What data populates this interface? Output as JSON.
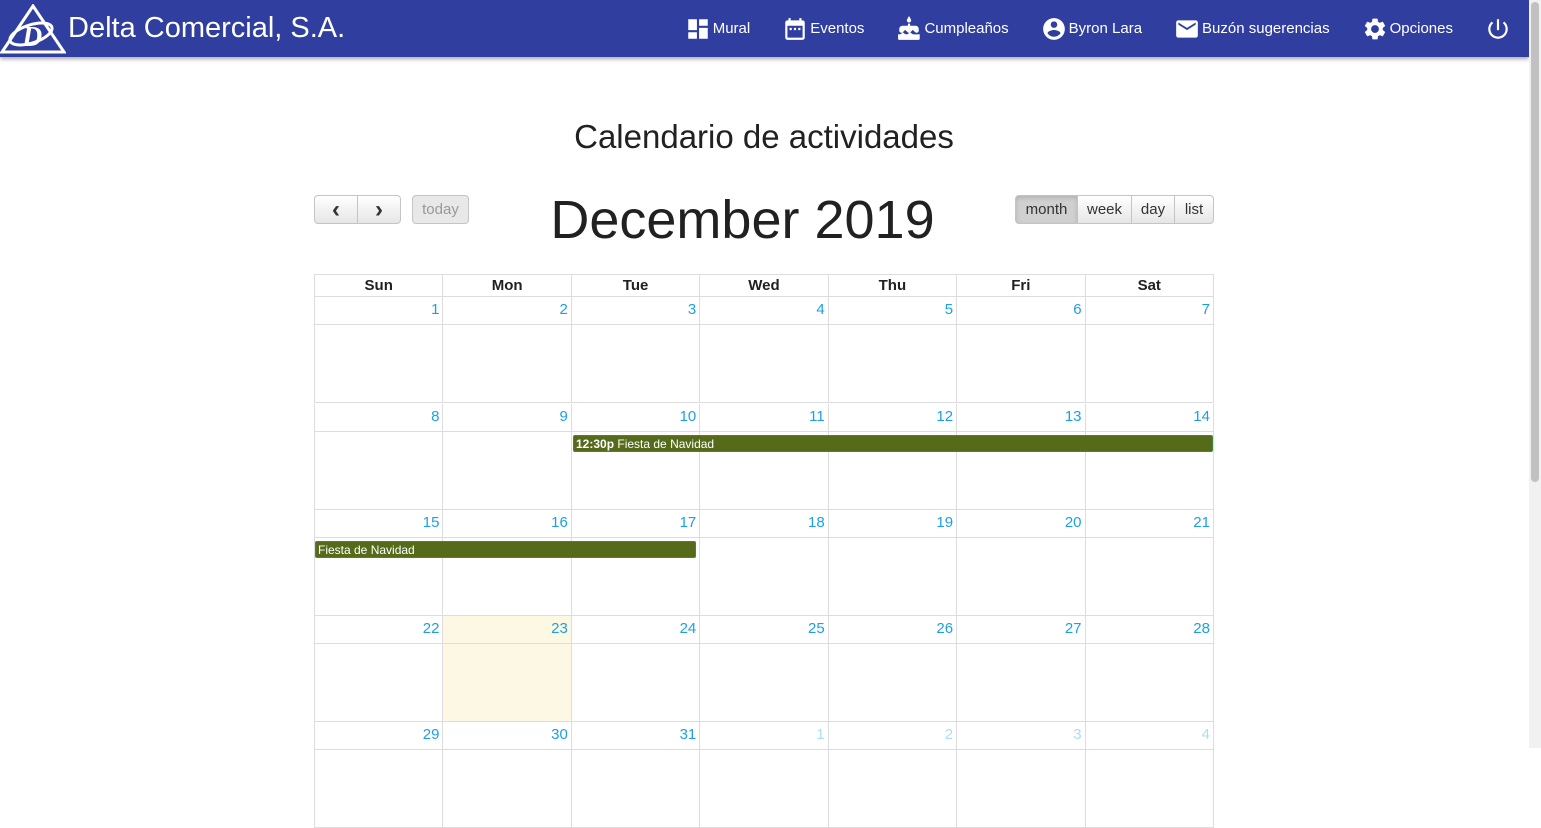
{
  "navbar": {
    "brand": "Delta Comercial, S.A.",
    "items": [
      {
        "label": "Mural",
        "icon": "dashboard-icon"
      },
      {
        "label": "Eventos",
        "icon": "calendar-icon"
      },
      {
        "label": "Cumpleaños",
        "icon": "cake-icon"
      },
      {
        "label": "Byron Lara",
        "icon": "account-circle-icon"
      },
      {
        "label": "Buzón sugerencias",
        "icon": "mail-icon"
      },
      {
        "label": "Opciones",
        "icon": "gear-icon"
      }
    ],
    "bg_color": "#303f9f"
  },
  "page_title": "Calendario de actividades",
  "calendar": {
    "title": "December 2019",
    "buttons": {
      "prev": "‹",
      "next": "›",
      "today": "today"
    },
    "views": {
      "month": "month",
      "week": "week",
      "day": "day",
      "list": "list",
      "active": "month"
    },
    "weekdays": [
      "Sun",
      "Mon",
      "Tue",
      "Wed",
      "Thu",
      "Fri",
      "Sat"
    ],
    "weeks": [
      [
        {
          "d": "1"
        },
        {
          "d": "2"
        },
        {
          "d": "3"
        },
        {
          "d": "4"
        },
        {
          "d": "5"
        },
        {
          "d": "6"
        },
        {
          "d": "7"
        }
      ],
      [
        {
          "d": "8"
        },
        {
          "d": "9"
        },
        {
          "d": "10"
        },
        {
          "d": "11"
        },
        {
          "d": "12"
        },
        {
          "d": "13"
        },
        {
          "d": "14"
        }
      ],
      [
        {
          "d": "15"
        },
        {
          "d": "16"
        },
        {
          "d": "17"
        },
        {
          "d": "18"
        },
        {
          "d": "19"
        },
        {
          "d": "20"
        },
        {
          "d": "21"
        }
      ],
      [
        {
          "d": "22"
        },
        {
          "d": "23",
          "today": true
        },
        {
          "d": "24"
        },
        {
          "d": "25"
        },
        {
          "d": "26"
        },
        {
          "d": "27"
        },
        {
          "d": "28"
        }
      ],
      [
        {
          "d": "29"
        },
        {
          "d": "30"
        },
        {
          "d": "31"
        },
        {
          "d": "1",
          "other": true
        },
        {
          "d": "2",
          "other": true
        },
        {
          "d": "3",
          "other": true
        },
        {
          "d": "4",
          "other": true
        }
      ]
    ],
    "events": [
      {
        "time": "12:30p",
        "title": "Fiesta de Navidad",
        "start": "2019-12-10",
        "end": "2019-12-17"
      }
    ],
    "event_segments": [
      {
        "time": "12:30p",
        "title": "Fiesta de Navidad"
      },
      {
        "time": "",
        "title": "Fiesta de Navidad"
      }
    ],
    "event_color": "#556b1a",
    "today_color": "#fcf8e3",
    "daynum_color": "#1ba1e2"
  }
}
